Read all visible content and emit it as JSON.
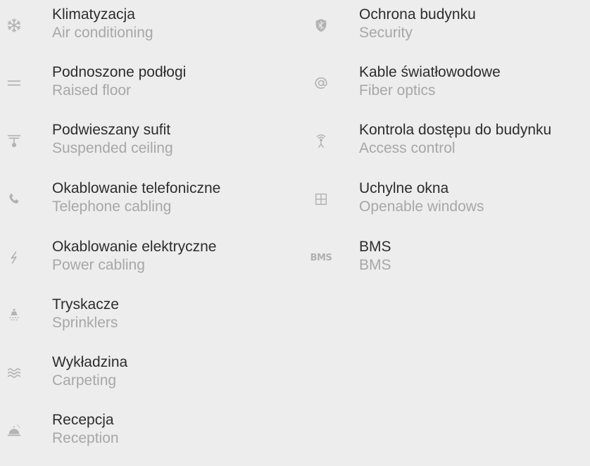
{
  "left_column": [
    {
      "icon": "snowflake-icon",
      "label": "Klimatyzacja",
      "sub": "Air conditioning"
    },
    {
      "icon": "raised-floor-icon",
      "label": "Podnoszone podłogi",
      "sub": "Raised floor"
    },
    {
      "icon": "suspended-ceiling-icon",
      "label": "Podwieszany sufit",
      "sub": "Suspended ceiling"
    },
    {
      "icon": "telephone-icon",
      "label": "Okablowanie telefoniczne",
      "sub": "Telephone cabling"
    },
    {
      "icon": "lightning-icon",
      "label": "Okablowanie elektryczne",
      "sub": "Power cabling"
    },
    {
      "icon": "sprinkler-icon",
      "label": "Tryskacze",
      "sub": "Sprinklers"
    },
    {
      "icon": "carpet-waves-icon",
      "label": "Wykładzina",
      "sub": "Carpeting"
    },
    {
      "icon": "reception-bell-icon",
      "label": "Recepcja",
      "sub": "Reception"
    }
  ],
  "right_column": [
    {
      "icon": "shield-icon",
      "label": "Ochrona budynku",
      "sub": "Security"
    },
    {
      "icon": "at-sign-icon",
      "label": "Kable światłowodowe",
      "sub": "Fiber optics"
    },
    {
      "icon": "access-antenna-icon",
      "label": "Kontrola dostępu do budynku",
      "sub": "Access control"
    },
    {
      "icon": "window-icon",
      "label": "Uchylne okna",
      "sub": "Openable windows"
    },
    {
      "icon": "bms-icon",
      "icon_text": "BMS",
      "label": "BMS",
      "sub": "BMS"
    }
  ]
}
